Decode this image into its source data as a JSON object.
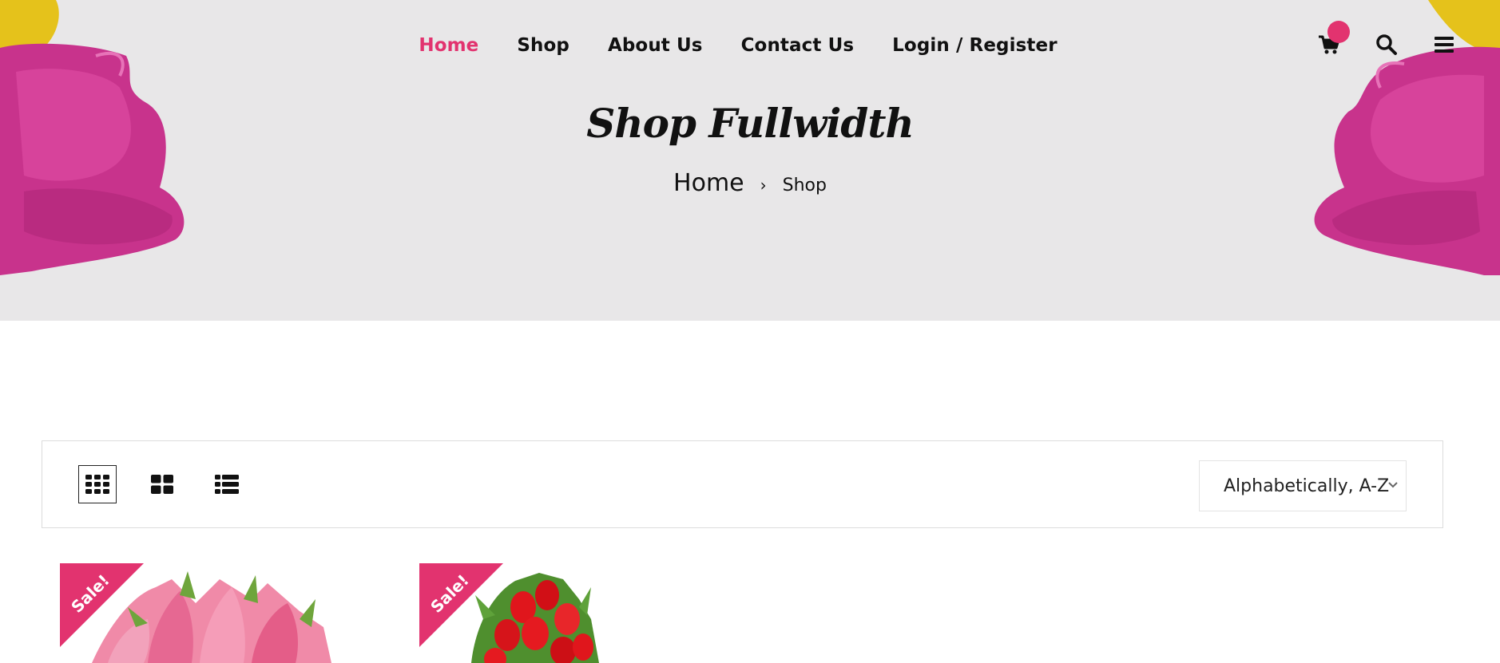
{
  "nav": {
    "items": [
      {
        "label": "Home",
        "active": true
      },
      {
        "label": "Shop",
        "active": false
      },
      {
        "label": "About Us",
        "active": false
      },
      {
        "label": "Contact Us",
        "active": false
      },
      {
        "label": "Login / Register",
        "active": false
      }
    ]
  },
  "header_icons": [
    "cart-icon",
    "search-icon",
    "menu-icon"
  ],
  "hero": {
    "title": "Shop Fullwidth",
    "breadcrumb": {
      "home": "Home",
      "separator": "›",
      "current": "Shop"
    }
  },
  "toolbar": {
    "views": [
      "grid-4-view",
      "grid-2-view",
      "list-view"
    ],
    "sort": {
      "selected": "Alphabetically, A-Z"
    }
  },
  "products": [
    {
      "badge": "Sale!",
      "image": "pink tulip bouquet"
    },
    {
      "badge": "Sale!",
      "image": "red tulip bouquet"
    }
  ],
  "colors": {
    "accent": "#e2336f",
    "hero_bg": "#e8e7e8",
    "text": "#111111"
  }
}
